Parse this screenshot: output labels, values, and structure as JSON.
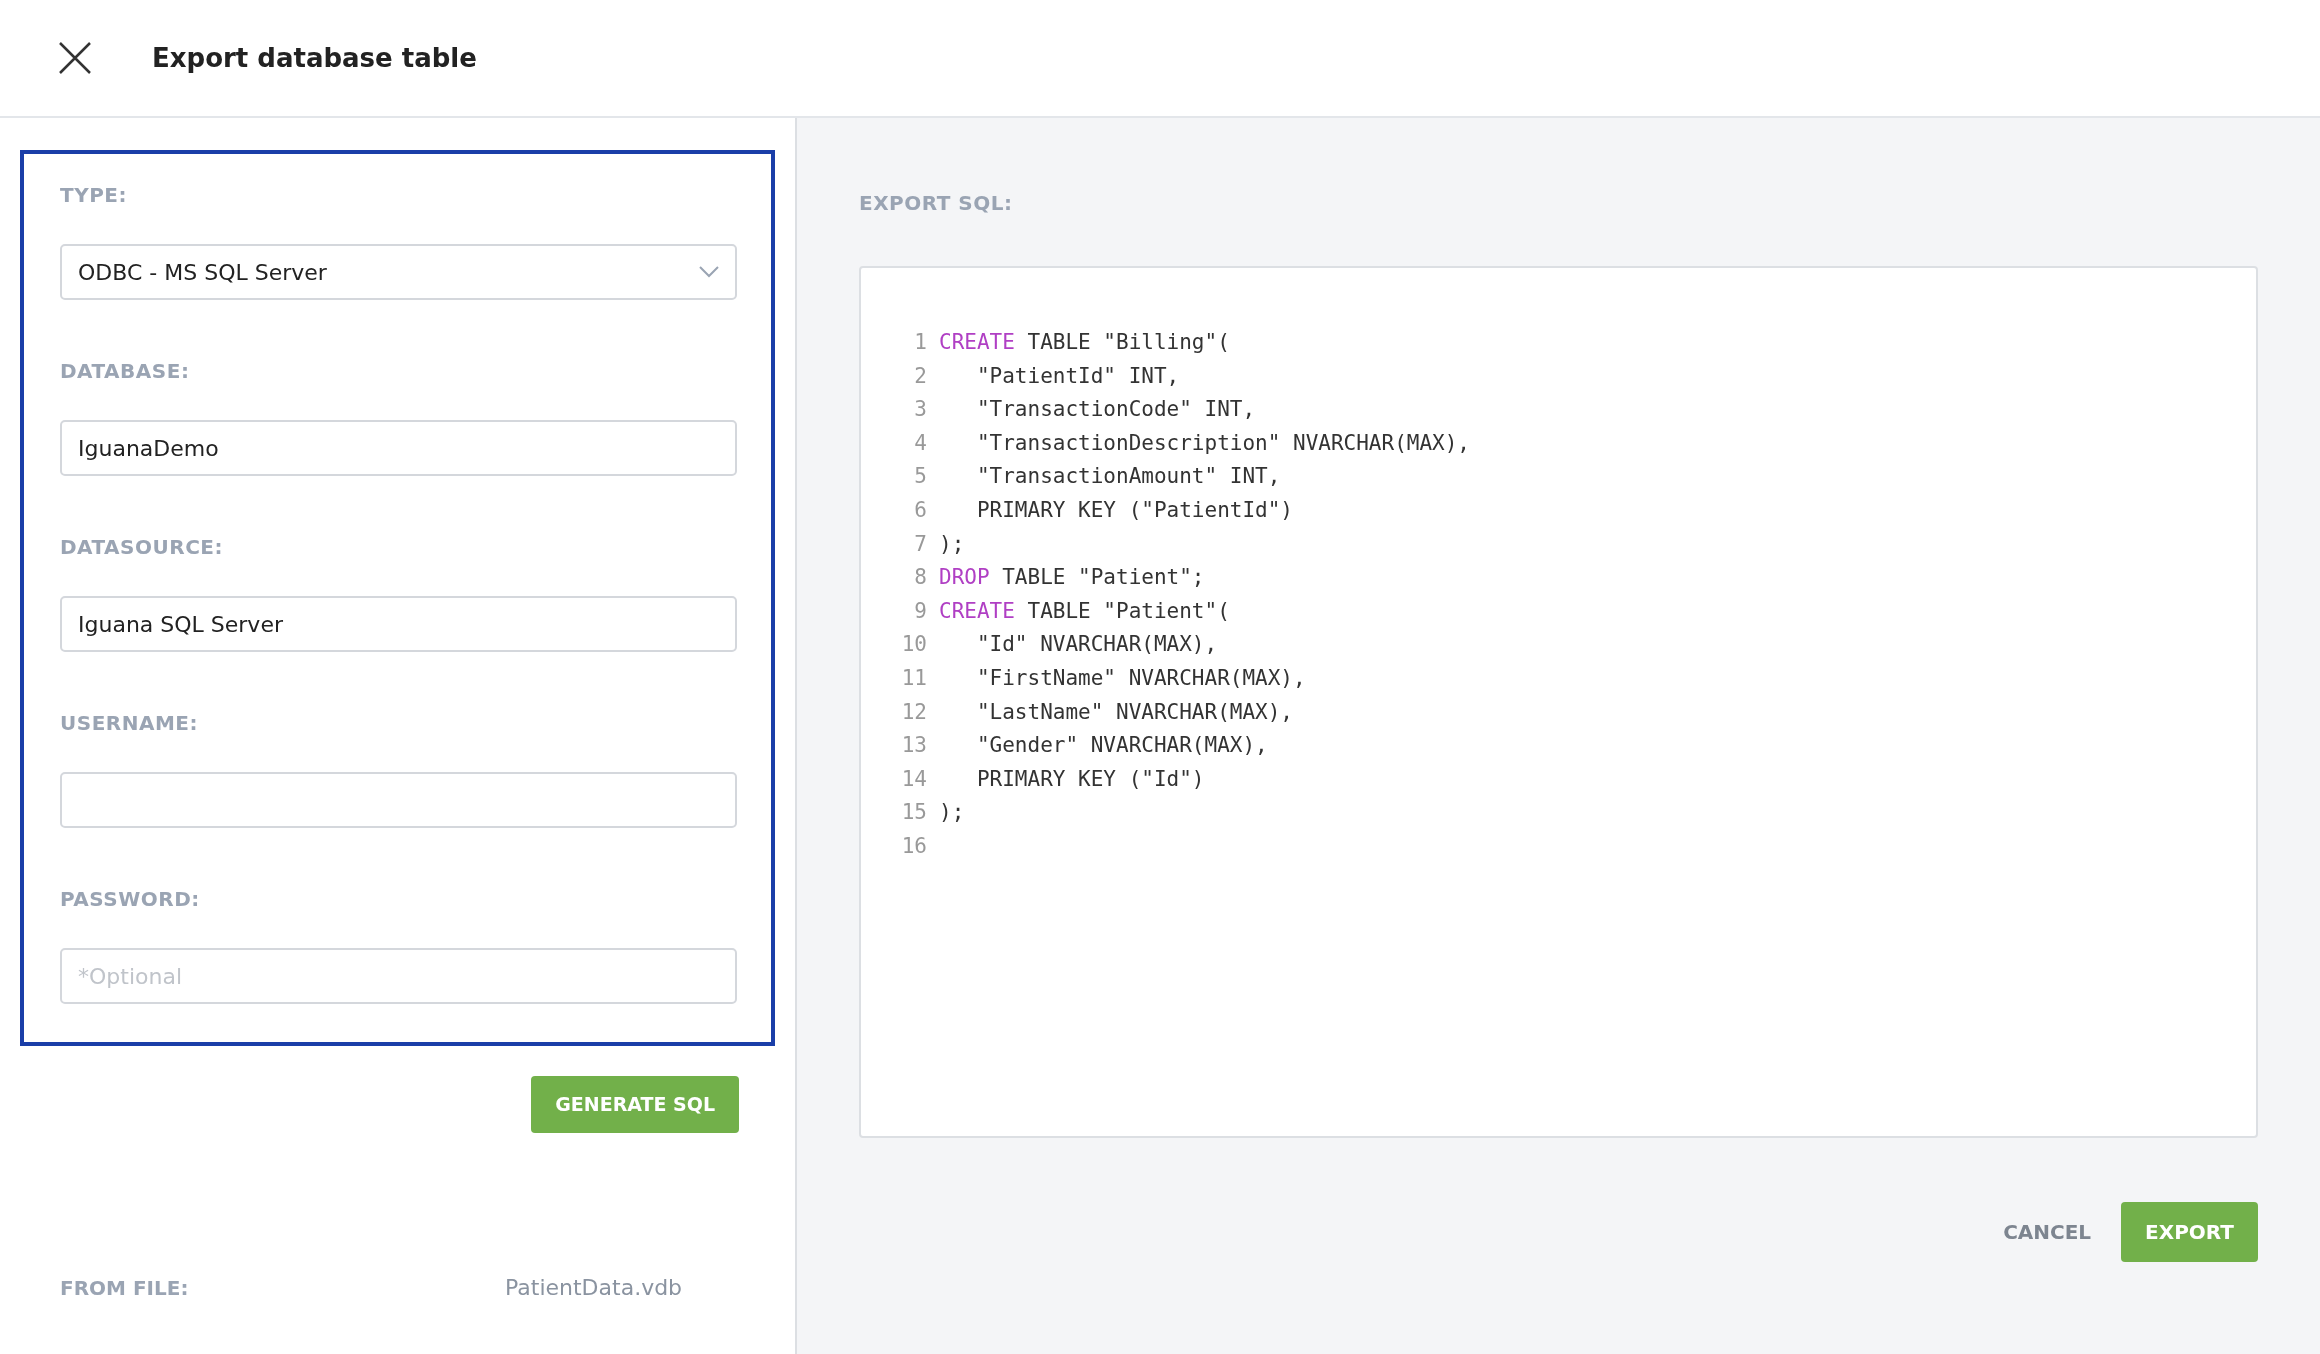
{
  "window": {
    "title": "Export database table"
  },
  "form": {
    "fields": [
      {
        "kind": "select",
        "label": "TYPE:",
        "value": "ODBC - MS SQL Server"
      },
      {
        "kind": "text",
        "label": "DATABASE:",
        "value": "IguanaDemo"
      },
      {
        "kind": "text",
        "label": "DATASOURCE:",
        "value": "Iguana SQL Server"
      },
      {
        "kind": "text",
        "label": "USERNAME:"
      },
      {
        "kind": "text",
        "label": "PASSWORD:",
        "placeholder": "*Optional"
      }
    ],
    "generate_button": "GENERATE SQL",
    "from_file": {
      "label": "FROM FILE:",
      "value": "PatientData.vdb"
    }
  },
  "export_sql": {
    "label": "EXPORT SQL:",
    "lines": [
      {
        "number": "1",
        "parts": [
          {
            "kind": "keyword",
            "text": "CREATE"
          },
          {
            "kind": "plain",
            "text": " TABLE \"Billing\"("
          }
        ]
      },
      {
        "number": "2",
        "parts": [
          {
            "kind": "plain",
            "text": "   \"PatientId\" INT,"
          }
        ]
      },
      {
        "number": "3",
        "parts": [
          {
            "kind": "plain",
            "text": "   \"TransactionCode\" INT,"
          }
        ]
      },
      {
        "number": "4",
        "parts": [
          {
            "kind": "plain",
            "text": "   \"TransactionDescription\" NVARCHAR(MAX),"
          }
        ]
      },
      {
        "number": "5",
        "parts": [
          {
            "kind": "plain",
            "text": "   \"TransactionAmount\" INT,"
          }
        ]
      },
      {
        "number": "6",
        "parts": [
          {
            "kind": "plain",
            "text": "   PRIMARY KEY (\"PatientId\")"
          }
        ]
      },
      {
        "number": "7",
        "parts": [
          {
            "kind": "plain",
            "text": ");"
          }
        ]
      },
      {
        "number": "8",
        "parts": [
          {
            "kind": "keyword",
            "text": "DROP"
          },
          {
            "kind": "plain",
            "text": " TABLE \"Patient\";"
          }
        ]
      },
      {
        "number": "9",
        "parts": [
          {
            "kind": "keyword",
            "text": "CREATE"
          },
          {
            "kind": "plain",
            "text": " TABLE \"Patient\"("
          }
        ]
      },
      {
        "number": "10",
        "parts": [
          {
            "kind": "plain",
            "text": "   \"Id\" NVARCHAR(MAX),"
          }
        ]
      },
      {
        "number": "11",
        "parts": [
          {
            "kind": "plain",
            "text": "   \"FirstName\" NVARCHAR(MAX),"
          }
        ]
      },
      {
        "number": "12",
        "parts": [
          {
            "kind": "plain",
            "text": "   \"LastName\" NVARCHAR(MAX),"
          }
        ]
      },
      {
        "number": "13",
        "parts": [
          {
            "kind": "plain",
            "text": "   \"Gender\" NVARCHAR(MAX),"
          }
        ]
      },
      {
        "number": "14",
        "parts": [
          {
            "kind": "plain",
            "text": "   PRIMARY KEY (\"Id\")"
          }
        ]
      },
      {
        "number": "15",
        "parts": [
          {
            "kind": "plain",
            "text": ");"
          }
        ]
      },
      {
        "number": "16"
      }
    ]
  },
  "buttons": {
    "cancel": "CANCEL",
    "export": "EXPORT"
  }
}
